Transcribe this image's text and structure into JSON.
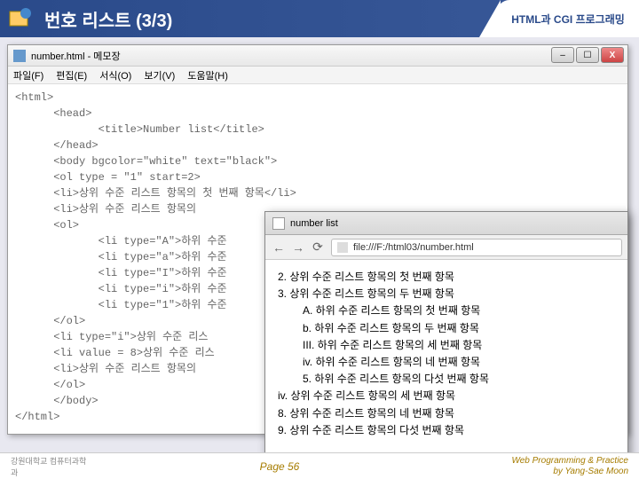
{
  "header": {
    "title": "번호 리스트 (3/3)",
    "subtitle": "HTML과 CGI 프로그래밍"
  },
  "notepad": {
    "title": "number.html - 메모장",
    "menu": [
      "파일(F)",
      "편집(E)",
      "서식(O)",
      "보기(V)",
      "도움말(H)"
    ],
    "code": [
      "<html>",
      "      <head>",
      "             <title>Number list</title>",
      "      </head>",
      "      <body bgcolor=\"white\" text=\"black\">",
      "      <ol type = \"1\" start=2>",
      "      <li>상위 수준 리스트 항목의 첫 번째 항목</li>",
      "      <li>상위 수준 리스트 항목의",
      "      <ol>",
      "             <li type=\"A\">하위 수준",
      "             <li type=\"a\">하위 수준",
      "             <li type=\"I\">하위 수준",
      "             <li type=\"i\">하위 수준",
      "             <li type=\"1\">하위 수준",
      "      </ol>",
      "      <li type=\"i\">상위 수준 리스",
      "      <li value = 8>상위 수준 리스",
      "      <li>상위 수준 리스트 항목의",
      "      </ol>",
      "      </body>",
      "</html>"
    ]
  },
  "browser": {
    "tab_title": "number list",
    "url": "file:///F:/html03/number.html",
    "list": {
      "top": [
        {
          "num": "2.",
          "text": "상위 수준 리스트 항목의 첫 번째 항목"
        },
        {
          "num": "3.",
          "text": "상위 수준 리스트 항목의 두 번째 항목"
        }
      ],
      "sub": [
        {
          "num": "A.",
          "text": "하위 수준 리스트 항목의 첫 번째 항목"
        },
        {
          "num": "b.",
          "text": "하위 수준 리스트 항목의 두 번째 항목"
        },
        {
          "num": "III.",
          "text": "하위 수준 리스트 항목의 세 번째 항목"
        },
        {
          "num": "iv.",
          "text": "하위 수준 리스트 항목의 네 번째 항목"
        },
        {
          "num": "5.",
          "text": "하위 수준 리스트 항목의 다섯 번째 항목"
        }
      ],
      "bottom": [
        {
          "num": "iv.",
          "text": "상위 수준 리스트 항목의 세 번째 항목"
        },
        {
          "num": "8.",
          "text": "상위 수준 리스트 항목의 네 번째 항목"
        },
        {
          "num": "9.",
          "text": "상위 수준 리스트 항목의 다섯 번째 항목"
        }
      ]
    }
  },
  "footer": {
    "logo": "강원대학교 컴퓨터과학과",
    "page": "Page 56",
    "credit1": "Web Programming & Practice",
    "credit2": "by Yang-Sae Moon"
  }
}
